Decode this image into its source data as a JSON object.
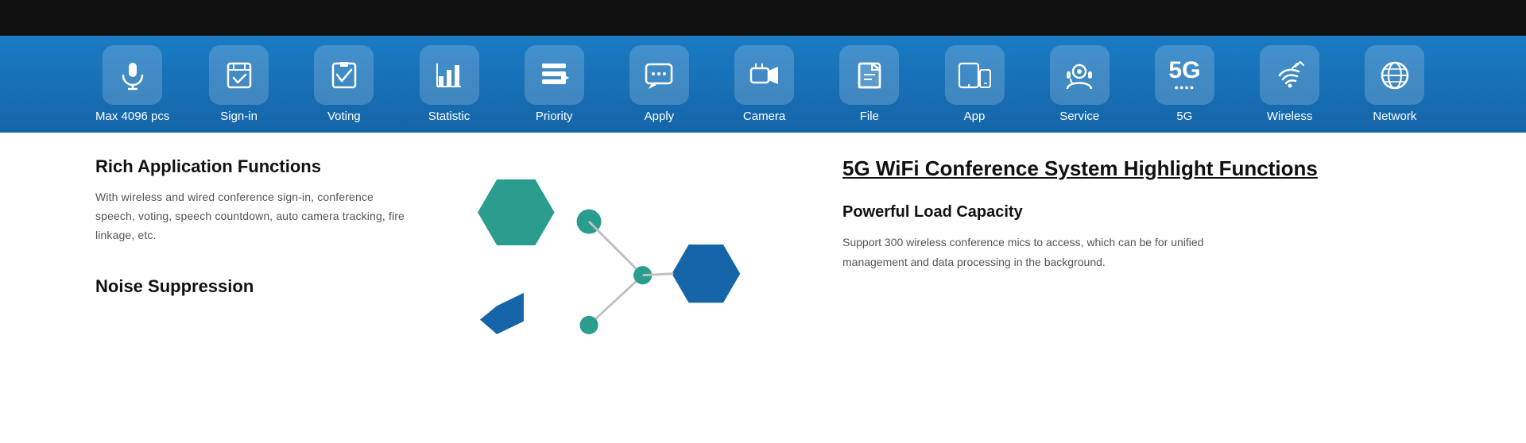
{
  "toolbar": {
    "items": [
      {
        "id": "max4096",
        "label": "Max 4096 pcs",
        "icon": "🎤"
      },
      {
        "id": "signin",
        "label": "Sign-in",
        "icon": "📋"
      },
      {
        "id": "voting",
        "label": "Voting",
        "icon": "🗳️"
      },
      {
        "id": "statistic",
        "label": "Statistic",
        "icon": "📊"
      },
      {
        "id": "priority",
        "label": "Priority",
        "icon": "🗂️"
      },
      {
        "id": "apply",
        "label": "Apply",
        "icon": "💬"
      },
      {
        "id": "camera",
        "label": "Camera",
        "icon": "📹"
      },
      {
        "id": "file",
        "label": "File",
        "icon": "📁"
      },
      {
        "id": "app",
        "label": "App",
        "icon": "📱"
      },
      {
        "id": "service",
        "label": "Service",
        "icon": "🎧"
      },
      {
        "id": "fiveg",
        "label": "5G",
        "icon": "5G"
      },
      {
        "id": "wireless",
        "label": "Wireless",
        "icon": "📶"
      },
      {
        "id": "network",
        "label": "Network",
        "icon": "🌐"
      }
    ]
  },
  "left": {
    "rich_title": "Rich Application Functions",
    "rich_text": "With wireless and wired conference sign-in, conference speech, voting, speech countdown, auto camera tracking, fire linkage, etc.",
    "noise_title": "Noise Suppression"
  },
  "right": {
    "highlight_title": "5G WiFi Conference System  Highlight Functions",
    "load_title": "Powerful Load Capacity",
    "load_text": "Support 300 wireless conference mics to access, which can be  for unified management and data processing in the background."
  }
}
